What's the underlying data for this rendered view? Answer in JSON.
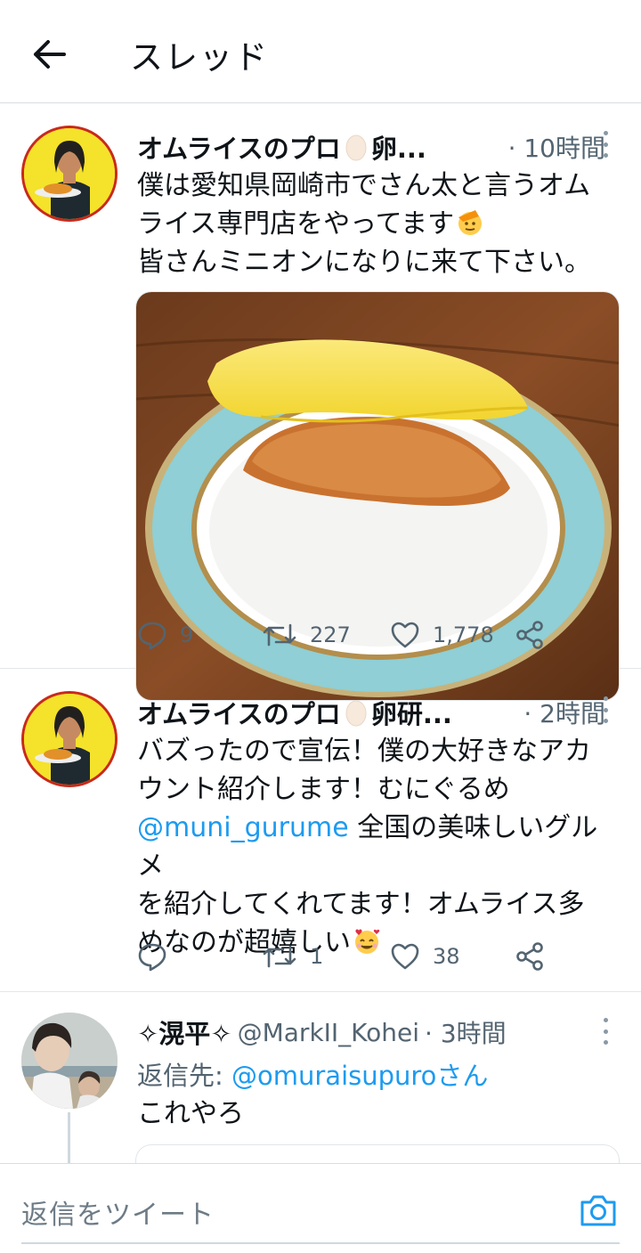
{
  "header": {
    "title": "スレッド"
  },
  "tweets": [
    {
      "name": "オムライスのプロ",
      "name_suffix": "卵...",
      "time": "· 10時間",
      "lines": [
        "僕は愛知県岡崎市でさん太と言うオム",
        "ライス専門店をやってます",
        "皆さんミニオンになりに来て下さい。"
      ],
      "replies": "9",
      "retweets": "227",
      "likes": "1,778"
    },
    {
      "name": "オムライスのプロ",
      "name_suffix": "卵研...",
      "time": "· 2時間",
      "lines": [
        "バズったので宣伝！僕の大好きなアカ",
        "ウント紹介します！むにぐるめ",
        "全国の美味しいグルメ",
        "を紹介してくれてます！オムライス多",
        "めなのが超嬉しい"
      ],
      "mention": "@muni_gurume",
      "replies": "",
      "retweets": "1",
      "likes": "38"
    },
    {
      "name": "✧滉平✧",
      "handle": "@MarkII_Kohei",
      "time": "· 3時間",
      "replying_prefix": "返信先: ",
      "replying_to": "@omuraisupuroさん",
      "text": "これやろ"
    }
  ],
  "composer": {
    "placeholder": "返信をツイート"
  },
  "colors": {
    "link": "#1d9bf0",
    "secondary_text": "#536471",
    "avatar_bg": "#f5e22a",
    "avatar_border": "#c9291c"
  }
}
